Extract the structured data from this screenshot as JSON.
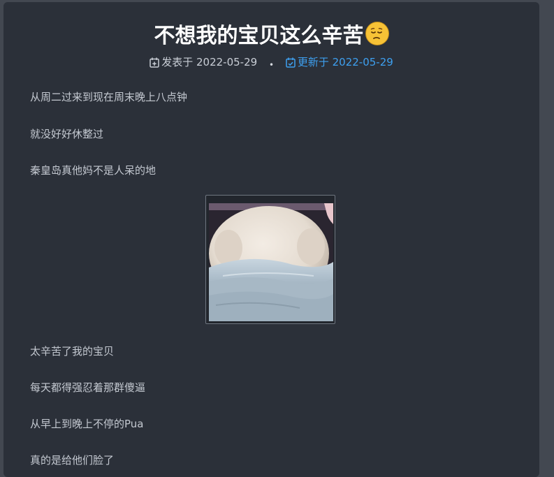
{
  "post": {
    "title": "不想我的宝贝这么辛苦",
    "published_label": "发表于",
    "published_date": "2022-05-29",
    "separator": "•",
    "updated_label": "更新于",
    "updated_date": "2022-05-29"
  },
  "paragraphs": [
    "从周二过来到现在周末晚上八点钟",
    "就没好好休整过",
    "秦皇岛真他妈不是人呆的地",
    "太辛苦了我的宝贝",
    "每天都得强忍着那群傻逼",
    "从早上到晚上不停的Pua",
    "真的是给他们脸了"
  ],
  "colors": {
    "page_bg": "#434851",
    "card_bg": "#2b3039",
    "title": "#ffffff",
    "body_text": "#c4c9d1",
    "updated_accent": "#3ea0f0"
  },
  "icons": {
    "published": "calendar-plus-icon",
    "updated": "calendar-check-icon",
    "title_emoji": "pensive-face-emoji"
  }
}
